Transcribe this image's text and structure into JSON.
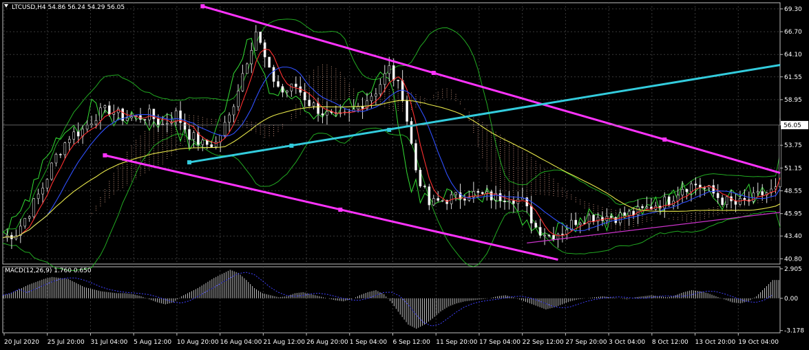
{
  "window": {
    "header": "LTCUSD,H4  54.86 56.24 54.29 56.05",
    "menu_icon": "triangle-down-icon"
  },
  "chart_data": [
    {
      "type": "candlestick",
      "symbol": "LTCUSD",
      "timeframe": "H4",
      "ohlc_last": {
        "open": 54.86,
        "high": 56.24,
        "low": 54.29,
        "close": 56.05
      },
      "current_price_label": "56.05",
      "y_ticks": [
        "69.30",
        "66.70",
        "64.10",
        "61.55",
        "58.95",
        "53.75",
        "51.15",
        "48.55",
        "45.95",
        "43.40",
        "40.80"
      ],
      "ylim": [
        40.2,
        70.0
      ],
      "x_ticks": [
        "20 Jul 2020",
        "25 Jul 20:00",
        "31 Jul 04:00",
        "5 Aug 12:00",
        "10 Aug 20:00",
        "16 Aug 04:00",
        "21 Aug 12:00",
        "26 Aug 20:00",
        "1 Sep 04:00",
        "6 Sep 12:00",
        "11 Sep 20:00",
        "17 Sep 04:00",
        "22 Sep 12:00",
        "27 Sep 20:00",
        "3 Oct 04:00",
        "8 Oct 12:00",
        "13 Oct 20:00",
        "19 Oct 04:00"
      ],
      "close_path": [
        [
          0,
          43.2
        ],
        [
          3,
          43.8
        ],
        [
          6,
          46.2
        ],
        [
          9,
          49.0
        ],
        [
          12,
          52.5
        ],
        [
          15,
          54.8
        ],
        [
          18,
          55.5
        ],
        [
          21,
          57.2
        ],
        [
          24,
          57.8
        ],
        [
          27,
          57.0
        ],
        [
          30,
          56.9
        ],
        [
          33,
          57.2
        ],
        [
          36,
          56.1
        ],
        [
          39,
          57.3
        ],
        [
          42,
          55.0
        ],
        [
          45,
          53.8
        ],
        [
          48,
          54.0
        ],
        [
          51,
          57.0
        ],
        [
          54,
          62.0
        ],
        [
          57,
          66.8
        ],
        [
          60,
          62.0
        ],
        [
          63,
          59.8
        ],
        [
          66,
          60.5
        ],
        [
          69,
          58.6
        ],
        [
          72,
          57.5
        ],
        [
          75,
          56.7
        ],
        [
          78,
          57.2
        ],
        [
          81,
          58.6
        ],
        [
          84,
          60.0
        ],
        [
          87,
          62.5
        ],
        [
          90,
          59.5
        ],
        [
          93,
          51.0
        ],
        [
          96,
          47.0
        ],
        [
          99,
          47.5
        ],
        [
          102,
          47.8
        ],
        [
          105,
          48.3
        ],
        [
          108,
          48.0
        ],
        [
          111,
          47.8
        ],
        [
          114,
          48.0
        ],
        [
          117,
          47.3
        ],
        [
          120,
          44.4
        ],
        [
          123,
          43.5
        ],
        [
          126,
          44.0
        ],
        [
          129,
          45.2
        ],
        [
          132,
          45.6
        ],
        [
          135,
          45.7
        ],
        [
          138,
          45.6
        ],
        [
          141,
          45.9
        ],
        [
          144,
          46.3
        ],
        [
          147,
          47.0
        ],
        [
          150,
          47.5
        ],
        [
          153,
          49.0
        ],
        [
          156,
          49.3
        ],
        [
          159,
          48.6
        ],
        [
          162,
          47.5
        ],
        [
          165,
          47.0
        ],
        [
          168,
          47.4
        ],
        [
          171,
          48.2
        ],
        [
          174,
          48.6
        ],
        [
          175,
          56.05
        ]
      ],
      "indicators": [
        "Moving averages (red, blue, yellow)",
        "Bollinger Bands (green)",
        "Ichimoku cloud"
      ],
      "trendlines": [
        {
          "name": "descending-channel-upper",
          "color": "#ff33ff"
        },
        {
          "name": "descending-channel-lower",
          "color": "#ff33ff"
        },
        {
          "name": "ascending-support",
          "color": "#cc33cc"
        },
        {
          "name": "rising-trendline",
          "color": "#33ccdd"
        }
      ]
    },
    {
      "type": "bar",
      "indicator": "MACD",
      "header": "MACD(12,26,9) 1.760 0.650",
      "y_ticks": [
        "2.905",
        "0.00",
        "-3.178"
      ],
      "ylim": [
        -3.4,
        3.1
      ],
      "histogram": [
        0.3,
        0.5,
        0.9,
        1.3,
        1.6,
        1.9,
        2.1,
        2.0,
        1.9,
        1.5,
        1.1,
        0.9,
        0.7,
        0.6,
        0.5,
        0.5,
        0.4,
        0.2,
        -0.1,
        -0.4,
        -0.6,
        -0.4,
        0.2,
        0.6,
        1.0,
        1.5,
        2.0,
        2.4,
        2.8,
        2.5,
        1.8,
        1.0,
        0.5,
        0.3,
        0.1,
        0.2,
        0.5,
        0.6,
        0.4,
        0.2,
        0.0,
        -0.2,
        -0.3,
        -0.1,
        0.3,
        0.6,
        0.8,
        0.4,
        -0.5,
        -1.6,
        -2.6,
        -3.0,
        -2.6,
        -2.0,
        -1.3,
        -0.8,
        -0.5,
        -0.3,
        -0.2,
        -0.1,
        0.0,
        0.2,
        0.3,
        0.1,
        -0.2,
        -0.5,
        -0.8,
        -1.1,
        -0.9,
        -0.6,
        -0.3,
        -0.1,
        0.0,
        0.1,
        0.2,
        0.1,
        0.0,
        -0.1,
        0.1,
        0.2,
        0.3,
        0.2,
        0.1,
        0.3,
        0.6,
        0.8,
        0.7,
        0.5,
        0.2,
        -0.1,
        -0.4,
        -0.5,
        -0.3,
        0.2,
        1.0,
        1.8
      ],
      "signal_color": "#4040ff",
      "histogram_color": "#c0c0c0"
    }
  ]
}
